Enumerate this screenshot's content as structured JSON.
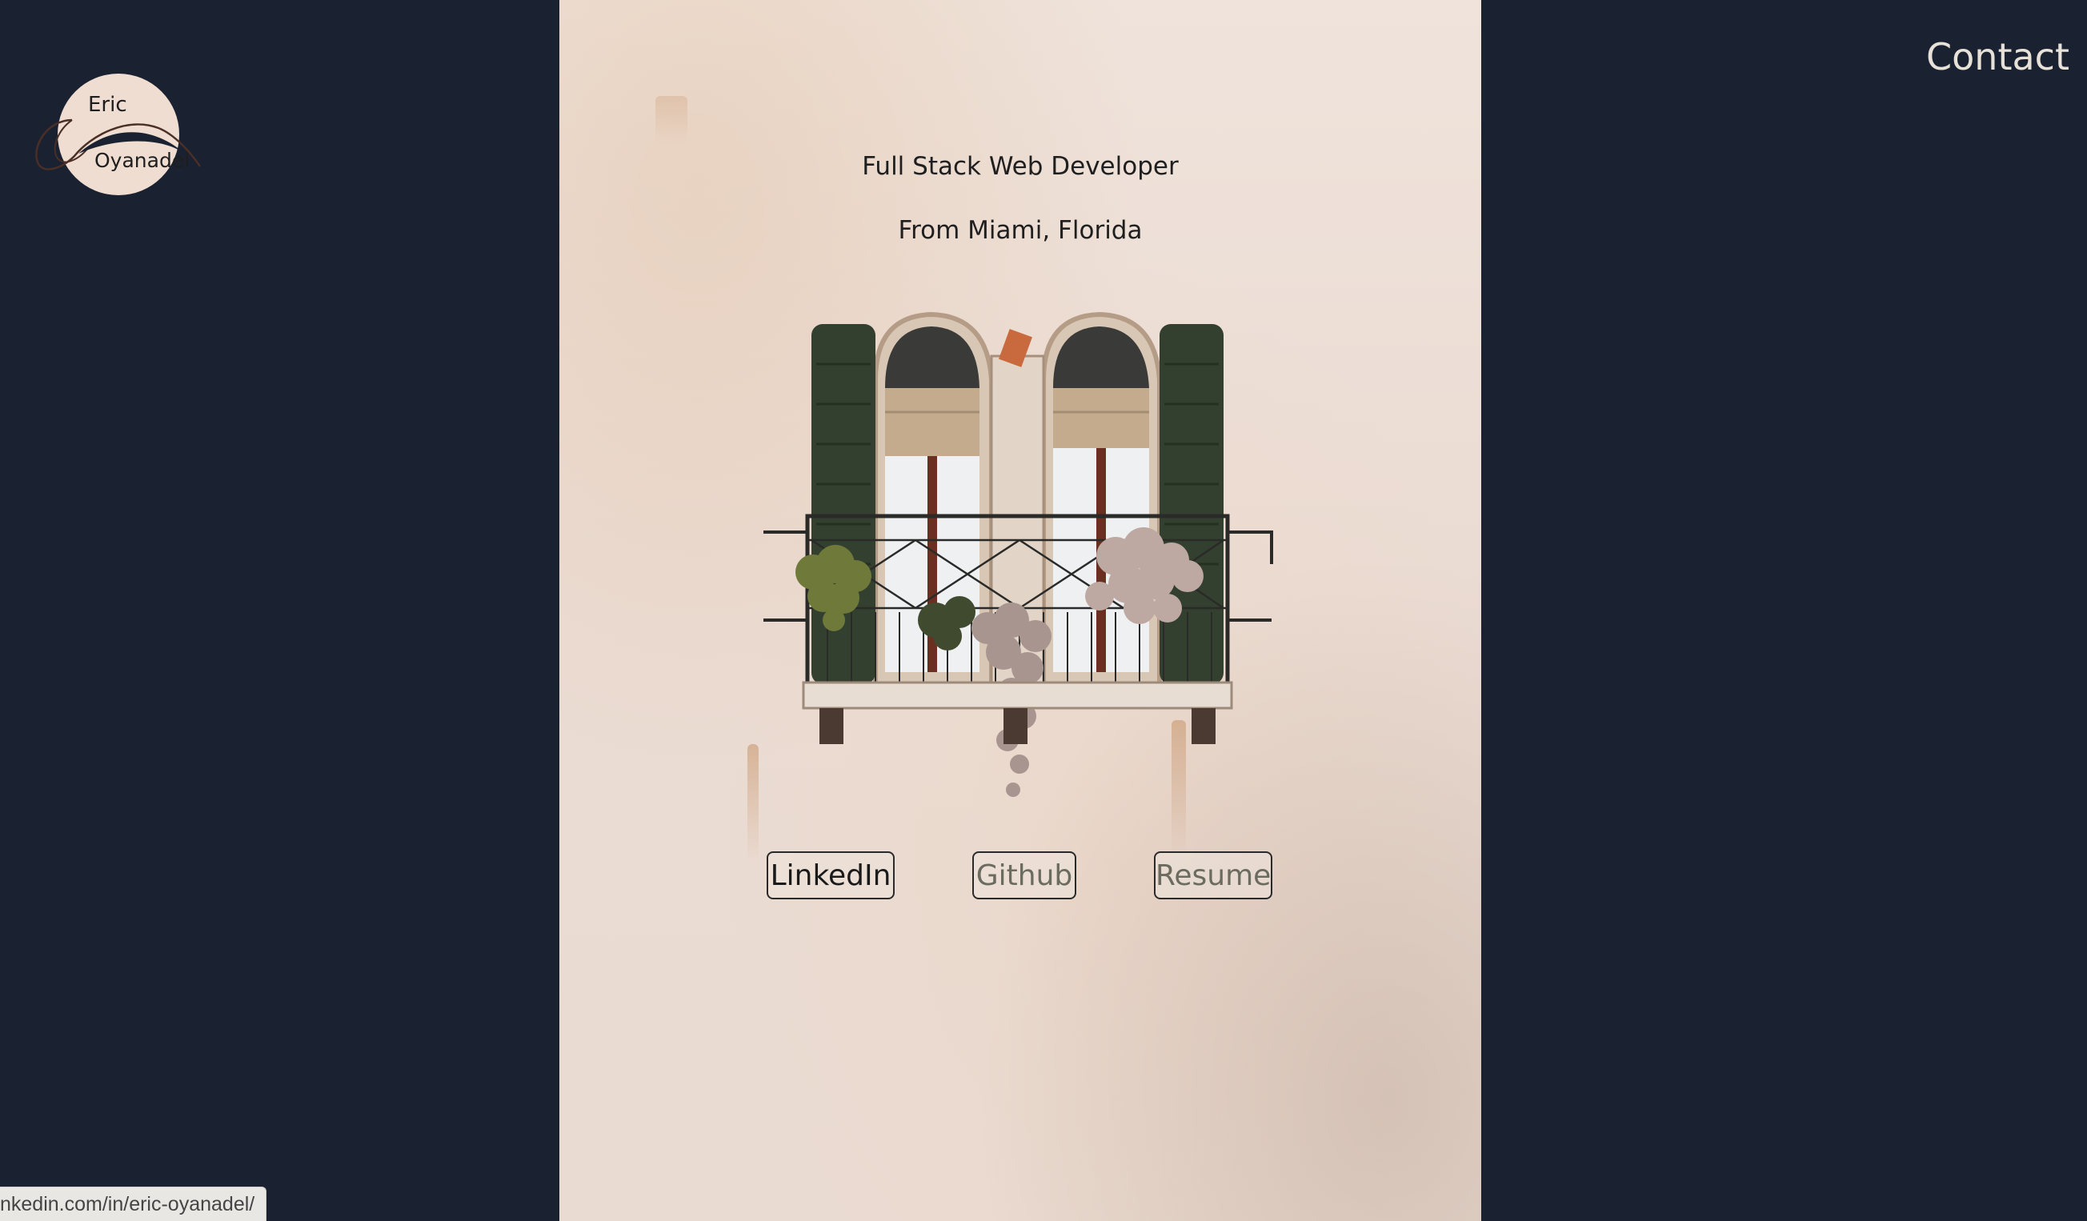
{
  "logo": {
    "first": "Eric",
    "last": "Oyanadel",
    "icon": "name-logo-emblem"
  },
  "nav": {
    "contact_label": "Contact"
  },
  "hero": {
    "title": "Full Stack Web Developer",
    "location": "From Miami, Florida",
    "image": "balcony-window-with-plants"
  },
  "links": [
    {
      "label": "LinkedIn"
    },
    {
      "label": "Github"
    },
    {
      "label": "Resume"
    }
  ],
  "status_bar": {
    "url": "nkedin.com/in/eric-oyanadel/"
  },
  "colors": {
    "background": "#1a2130",
    "panel": "#ecdfd6",
    "text_dark": "#1f1f1f",
    "text_light": "#e7e1d8",
    "logo_fill": "#eeddd0"
  }
}
